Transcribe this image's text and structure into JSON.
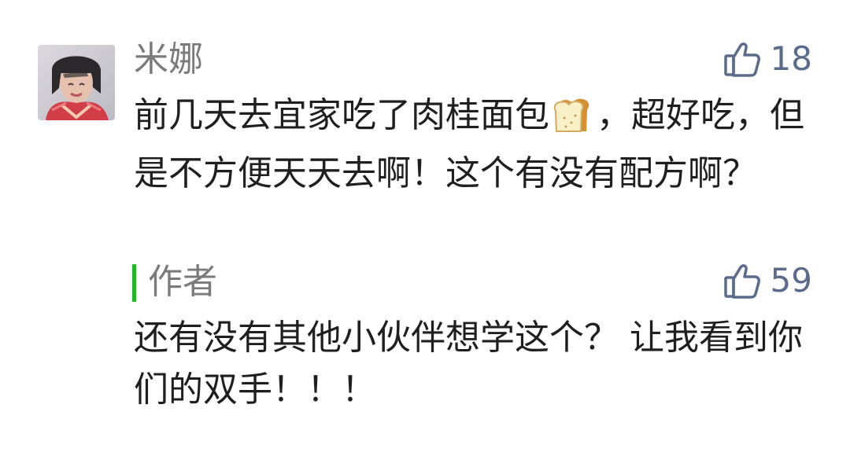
{
  "comment": {
    "username": "米娜",
    "like_count": "18",
    "text_before_emoji": "前几天去宜家吃了肉桂面包",
    "emoji": "bread-emoji",
    "text_after_emoji": "，超好吃，但是不方便天天去啊！这个有没有配方啊？"
  },
  "reply": {
    "author_label": "作者",
    "like_count": "59",
    "text": "还有没有其他小伙伴想学这个？ 让我看到你们的双手！！！",
    "accent_color": "#1fb924"
  },
  "colors": {
    "like_icon": "#5a6b8c",
    "name_gray": "#7a7a7a",
    "text": "#1f1f1f"
  },
  "icons": {
    "like": "thumbs-up-icon",
    "emoji": "bread-emoji-icon"
  }
}
